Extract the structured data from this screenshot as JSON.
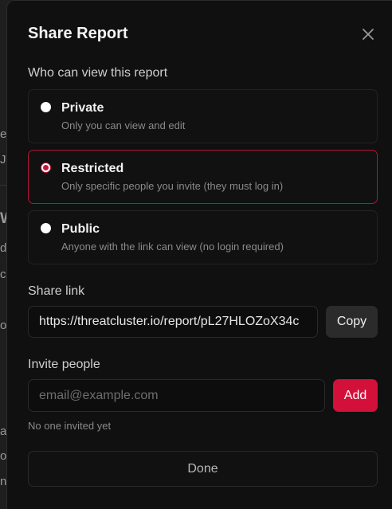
{
  "dialog": {
    "title": "Share Report",
    "close_icon": "close-icon"
  },
  "visibility": {
    "label": "Who can view this report",
    "selected": "restricted",
    "options": [
      {
        "id": "private",
        "title": "Private",
        "description": "Only you can view and edit"
      },
      {
        "id": "restricted",
        "title": "Restricted",
        "description": "Only specific people you invite (they must log in)"
      },
      {
        "id": "public",
        "title": "Public",
        "description": "Anyone with the link can view (no login required)"
      }
    ]
  },
  "share_link": {
    "label": "Share link",
    "value": "https://threatcluster.io/report/pL27HLOZoX34c",
    "copy_label": "Copy"
  },
  "invite": {
    "label": "Invite people",
    "placeholder": "email@example.com",
    "add_label": "Add",
    "empty_text": "No one invited yet"
  },
  "footer": {
    "done_label": "Done"
  },
  "colors": {
    "accent": "#d3103a",
    "selected_border": "#b31437",
    "background": "#101010"
  }
}
